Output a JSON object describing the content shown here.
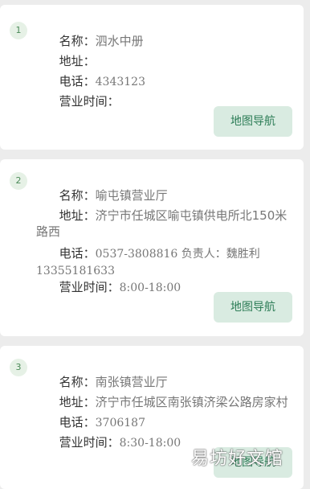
{
  "stores": [
    {
      "index": "1",
      "name_label": "名称：",
      "name": "泗水中册",
      "address_label": "地址：",
      "address": "",
      "phone_label": "电话：",
      "phone": "4343123",
      "hours_label": "营业时间：",
      "hours": "",
      "nav_label": "地图导航"
    },
    {
      "index": "2",
      "name_label": "名称：",
      "name": "喻屯镇营业厅",
      "address_label": "地址：",
      "address": "济宁市任城区喻屯镇供电所北150米路西",
      "phone_label": "电话：",
      "phone": "0537-3808816 负责人：魏胜利 13355181633",
      "hours_label": "营业时间：",
      "hours": "8:00-18:00",
      "nav_label": "地图导航"
    },
    {
      "index": "3",
      "name_label": "名称：",
      "name": "南张镇营业厅",
      "address_label": "地址：",
      "address": "济宁市任城区南张镇济梁公路房家村",
      "phone_label": "电话：",
      "phone": "3706187",
      "hours_label": "营业时间：",
      "hours": "8:30-18:00",
      "nav_label": "地图导航"
    }
  ],
  "watermark": "易坊好文馆"
}
